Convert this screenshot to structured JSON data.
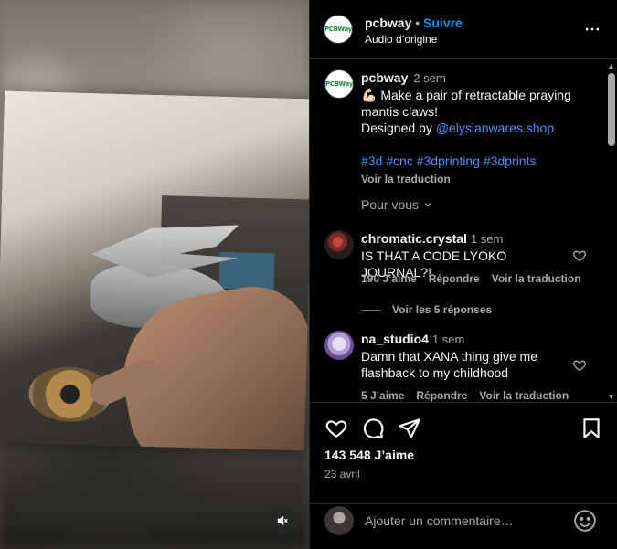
{
  "post": {
    "username": "pcbway",
    "follow_label": "Suivre",
    "audio_label": "Audio d’origine",
    "logo_text": "PCBWay"
  },
  "caption": {
    "username": "pcbway",
    "time": "2 sem",
    "line1": "💪🏻 Make a pair of retractable praying mantis claws!",
    "designed_by": "Designed by ",
    "mention": "@elysianwares.shop",
    "hashtags": [
      "#3d",
      "#cnc",
      "#3dprinting",
      "#3dprints"
    ],
    "translate_label": "Voir la traduction",
    "for_you_label": "Pour vous"
  },
  "comments": [
    {
      "username": "chromatic.crystal",
      "time": "1 sem",
      "text": "IS THAT A CODE LYOKO JOURNAL?!",
      "likes": "190 J’aime",
      "reply_label": "Répondre",
      "translate_label": "Voir la traduction",
      "replies_label": "Voir les 5 réponses"
    },
    {
      "username": "na_studio4",
      "time": "1 sem",
      "text": "Damn that XANA thing give me flashback to my childhood",
      "likes": "5 J’aime",
      "reply_label": "Répondre",
      "translate_label": "Voir la traduction"
    }
  ],
  "footer": {
    "likes_count": "143 548 J’aime",
    "date": "23 avril",
    "comment_placeholder": "Ajouter un commentaire…"
  },
  "icons": {
    "more": "more-horizontal-icon",
    "heart": "heart-icon",
    "comment": "comment-icon",
    "share": "share-icon",
    "save": "bookmark-icon",
    "emoji": "emoji-icon",
    "mute": "volume-off-icon"
  },
  "colors": {
    "accent_blue": "#0095f6",
    "link_blue": "#4f8ff7",
    "muted_text": "#a8a8a8",
    "background": "#000000"
  }
}
